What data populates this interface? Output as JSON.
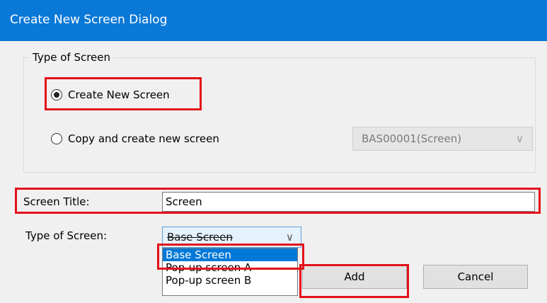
{
  "window": {
    "title": "Create New Screen Dialog"
  },
  "type_group": {
    "legend": "Type of Screen",
    "options": [
      {
        "label": "Create New Screen",
        "checked": true
      },
      {
        "label": "Copy and create new screen",
        "checked": false
      }
    ],
    "copy_source": {
      "value": "BAS00001(Screen)",
      "chevron": "∨"
    }
  },
  "screen_title": {
    "label": "Screen Title:",
    "value": "Screen"
  },
  "screen_type": {
    "label": "Type of Screen:",
    "selected": "Base Screen",
    "chevron": "∨",
    "options": [
      "Base Screen",
      "Pop-up screen A",
      "Pop-up screen B"
    ]
  },
  "buttons": {
    "add": "Add",
    "cancel": "Cancel"
  },
  "colors": {
    "titlebar": "#0a78d7",
    "highlight": "#e3101a",
    "selection": "#0078d7"
  }
}
